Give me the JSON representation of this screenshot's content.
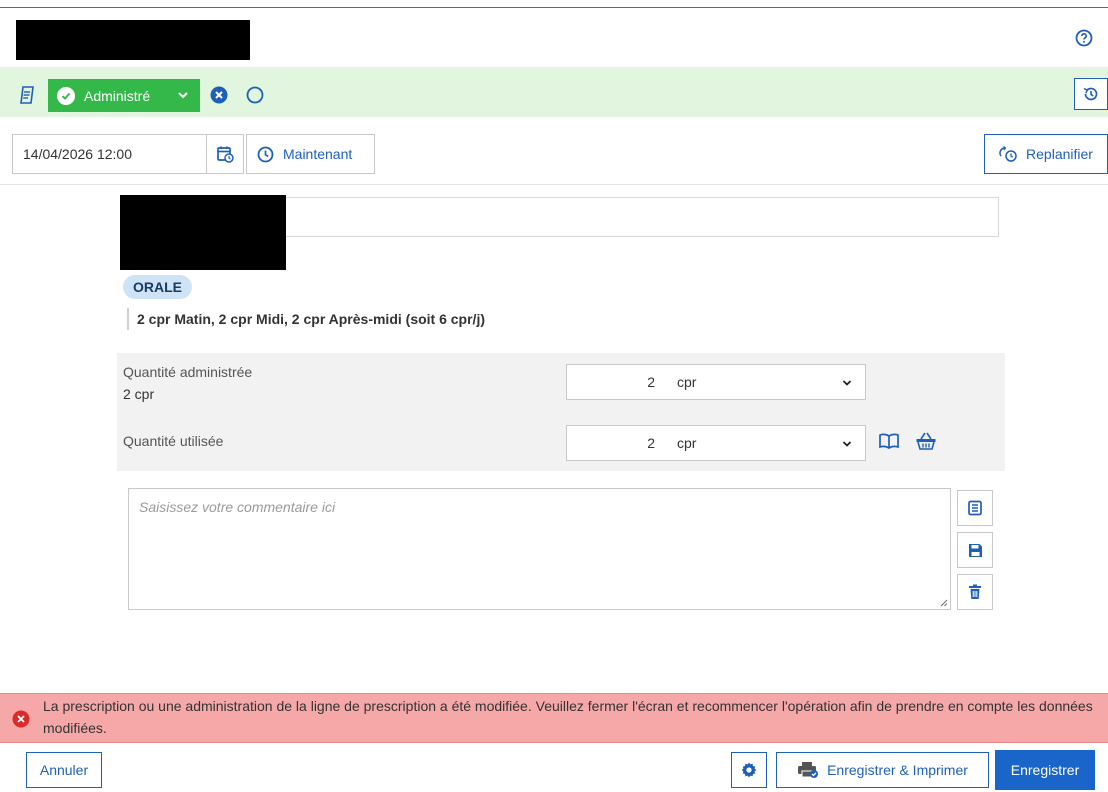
{
  "header": {
    "help_icon": "question-circle-icon"
  },
  "status_bar": {
    "note_icon": "document-pen-icon",
    "status_label": "Administré",
    "history_icon": "history-icon",
    "colors": {
      "status_bg": "#34b849",
      "bar_bg": "#e2f6df",
      "accent": "#1f5fb8"
    }
  },
  "datetime": {
    "value": "14/04/2026 12:00",
    "now_label": "Maintenant",
    "replan_label": "Replanifier"
  },
  "medication": {
    "route": "ORALE",
    "posology": "2 cpr Matin, 2 cpr Midi, 2 cpr Après-midi (soit 6 cpr/j)"
  },
  "quantities": {
    "administered": {
      "label": "Quantité administrée",
      "sub": "2 cpr",
      "value": "2",
      "unit": "cpr"
    },
    "used": {
      "label": "Quantité utilisée",
      "value": "2",
      "unit": "cpr"
    }
  },
  "comment": {
    "placeholder": "Saisissez votre commentaire ici"
  },
  "error": {
    "message": "La prescription ou une administration de la ligne de prescription a été modifiée. Veuillez fermer l'écran et recommencer l'opération afin de prendre en compte les données modifiées.",
    "color": "#f6a8a8"
  },
  "footer": {
    "cancel_label": "Annuler",
    "save_print_label": "Enregistrer & Imprimer",
    "save_label": "Enregistrer"
  }
}
